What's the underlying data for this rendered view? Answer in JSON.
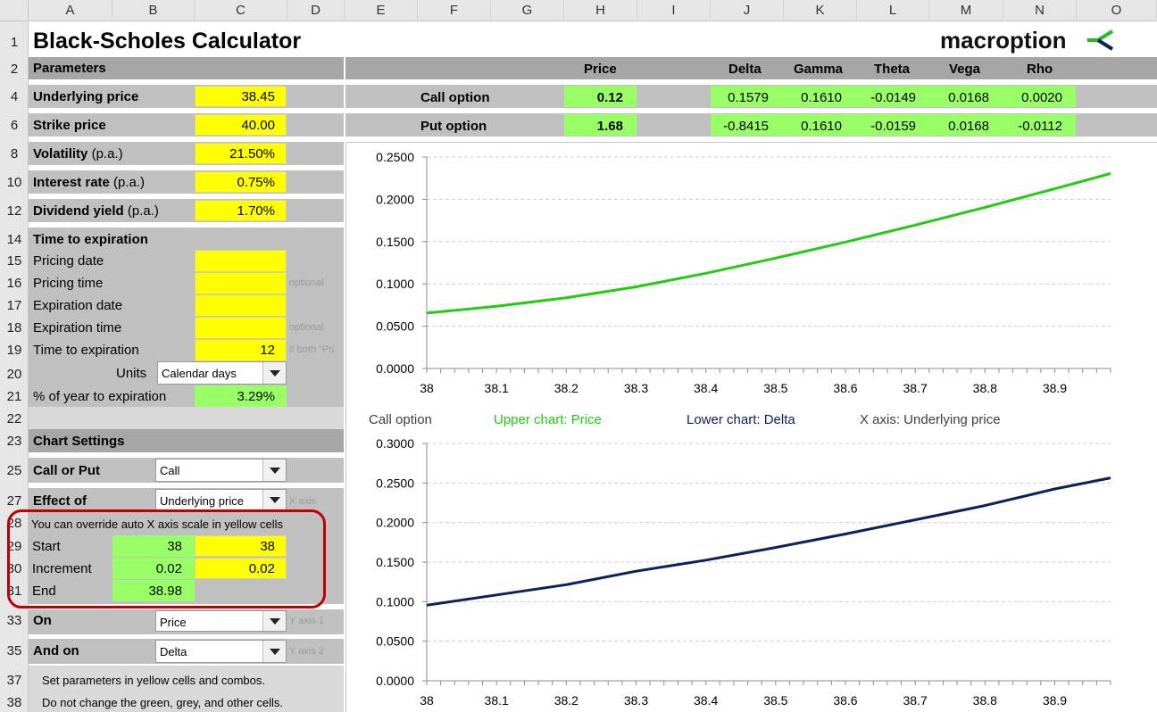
{
  "title": "Black-Scholes Calculator",
  "logo": {
    "text": "macroption"
  },
  "columns": [
    "A",
    "B",
    "C",
    "D",
    "E",
    "F",
    "G",
    "H",
    "I",
    "J",
    "K",
    "L",
    "M",
    "N",
    "O"
  ],
  "rows": [
    "1",
    "2",
    "4",
    "6",
    "8",
    "10",
    "12",
    "14",
    "15",
    "16",
    "17",
    "18",
    "19",
    "20",
    "21",
    "22",
    "23",
    "25",
    "27",
    "28",
    "29",
    "30",
    "31",
    "33",
    "35",
    "37",
    "38"
  ],
  "parameters": {
    "header": "Parameters",
    "underlying": {
      "label": "Underlying price",
      "value": "38.45"
    },
    "strike": {
      "label": "Strike price",
      "value": "40.00"
    },
    "volatility": {
      "label": "Volatility",
      "suffix": " (p.a.)",
      "value": "21.50%"
    },
    "interest": {
      "label": "Interest rate",
      "suffix": " (p.a.)",
      "value": "0.75%"
    },
    "dividend": {
      "label": "Dividend yield",
      "suffix": " (p.a.)",
      "value": "1.70%"
    }
  },
  "time": {
    "header": "Time to expiration",
    "pricing_date": "Pricing date",
    "pricing_time": "Pricing time",
    "expiration_date": "Expiration date",
    "expiration_time": "Expiration time",
    "time_to_expiration": "Time to expiration",
    "time_value": "12",
    "units_label": "Units",
    "units_value": "Calendar days",
    "pct_label": "% of year to expiration",
    "pct_value": "3.29%",
    "note_optional1": "optional",
    "note_optional2": "optional",
    "note_ifboth": "if both \"Pri"
  },
  "chart_settings": {
    "header": "Chart Settings",
    "call_put_label": "Call or Put",
    "call_put_value": "Call",
    "effect_label": "Effect of",
    "effect_value": "Underlying price",
    "effect_note": "X axis",
    "override_note": "You can override auto X axis scale in yellow cells",
    "start_label": "Start",
    "start_auto": "38",
    "start_override": "38",
    "increment_label": "Increment",
    "increment_auto": "0.02",
    "increment_override": "0.02",
    "end_label": "End",
    "end_value": "38.98",
    "on_label": "On",
    "on_value": "Price",
    "on_note": "Y axis 1",
    "and_on_label": "And on",
    "and_on_value": "Delta",
    "and_on_note": "Y axis 2",
    "instr1": "Set parameters in yellow cells and combos.",
    "instr2": "Do not change the green, grey, and other cells."
  },
  "results": {
    "headers": [
      "Price",
      "Delta",
      "Gamma",
      "Theta",
      "Vega",
      "Rho"
    ],
    "call": {
      "label": "Call option",
      "price": "0.12",
      "greeks": [
        "0.1579",
        "0.1610",
        "-0.0149",
        "0.0168",
        "0.0020"
      ]
    },
    "put": {
      "label": "Put option",
      "price": "1.68",
      "greeks": [
        "-0.8415",
        "0.1610",
        "-0.0159",
        "0.0168",
        "-0.0112"
      ]
    }
  },
  "legend": {
    "option": "Call option",
    "upper": "Upper chart: Price",
    "lower": "Lower chart: Delta",
    "xaxis": "X axis: Underlying price"
  },
  "colors": {
    "yellow": "#ffff00",
    "green": "#99ff66",
    "upper_line": "#22cc11",
    "lower_line": "#0d1f5c",
    "highlight": "#c00000"
  },
  "chart_data": [
    {
      "type": "line",
      "name": "upper",
      "x": [
        38,
        38.1,
        38.2,
        38.3,
        38.4,
        38.5,
        38.6,
        38.7,
        38.8,
        38.9,
        38.98
      ],
      "y": [
        0.0655,
        0.0735,
        0.0835,
        0.0965,
        0.1125,
        0.1305,
        0.1495,
        0.1695,
        0.1905,
        0.2125,
        0.2305
      ],
      "xticks": [
        "38",
        "38.1",
        "38.2",
        "38.3",
        "38.4",
        "38.5",
        "38.6",
        "38.7",
        "38.8",
        "38.9"
      ],
      "yticks": [
        "0.0000",
        "0.0500",
        "0.1000",
        "0.1500",
        "0.2000",
        "0.2500"
      ],
      "xlim": [
        38,
        38.98
      ],
      "ylim": [
        0,
        0.25
      ],
      "grid": true
    },
    {
      "type": "line",
      "name": "lower",
      "x": [
        38,
        38.1,
        38.2,
        38.3,
        38.4,
        38.5,
        38.6,
        38.7,
        38.8,
        38.9,
        38.98
      ],
      "y": [
        0.0955,
        0.1085,
        0.1215,
        0.1385,
        0.1525,
        0.1685,
        0.1855,
        0.2035,
        0.2215,
        0.2425,
        0.2565
      ],
      "xticks": [
        "38",
        "38.1",
        "38.2",
        "38.3",
        "38.4",
        "38.5",
        "38.6",
        "38.7",
        "38.8",
        "38.9"
      ],
      "yticks": [
        "0.0000",
        "0.0500",
        "0.1000",
        "0.1500",
        "0.2000",
        "0.2500",
        "0.3000"
      ],
      "xlim": [
        38,
        38.98
      ],
      "ylim": [
        0,
        0.3
      ],
      "grid": true
    }
  ]
}
